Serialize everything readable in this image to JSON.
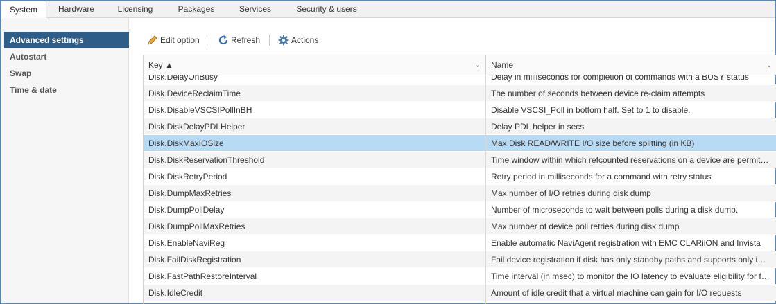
{
  "tabs": [
    {
      "label": "System",
      "active": true
    },
    {
      "label": "Hardware",
      "active": false
    },
    {
      "label": "Licensing",
      "active": false
    },
    {
      "label": "Packages",
      "active": false
    },
    {
      "label": "Services",
      "active": false
    },
    {
      "label": "Security & users",
      "active": false
    }
  ],
  "sidebar": {
    "items": [
      {
        "label": "Advanced settings",
        "active": true
      },
      {
        "label": "Autostart",
        "active": false
      },
      {
        "label": "Swap",
        "active": false
      },
      {
        "label": "Time & date",
        "active": false
      }
    ]
  },
  "toolbar": {
    "edit_label": "Edit option",
    "refresh_label": "Refresh",
    "actions_label": "Actions",
    "edit_icon": "pencil-icon",
    "refresh_icon": "refresh-icon",
    "actions_icon": "gear-icon"
  },
  "grid": {
    "columns": {
      "key": "Key ▲",
      "name": "Name"
    },
    "rows": [
      {
        "key": "Disk.DelayOnBusy",
        "name": "Delay in milliseconds for completion of commands with a BUSY status"
      },
      {
        "key": "Disk.DeviceReclaimTime",
        "name": "The number of seconds between device re-claim attempts"
      },
      {
        "key": "Disk.DisableVSCSIPollInBH",
        "name": "Disable VSCSI_Poll in bottom half. Set to 1 to disable."
      },
      {
        "key": "Disk.DiskDelayPDLHelper",
        "name": "Delay PDL helper in secs"
      },
      {
        "key": "Disk.DiskMaxIOSize",
        "name": "Max Disk READ/WRITE I/O size before splitting (in KB)",
        "selected": true
      },
      {
        "key": "Disk.DiskReservationThreshold",
        "name": "Time window within which refcounted reservations on a device are permitted"
      },
      {
        "key": "Disk.DiskRetryPeriod",
        "name": "Retry period in milliseconds for a command with retry status"
      },
      {
        "key": "Disk.DumpMaxRetries",
        "name": "Max number of I/O retries during disk dump"
      },
      {
        "key": "Disk.DumpPollDelay",
        "name": "Number of microseconds to wait between polls during a disk dump."
      },
      {
        "key": "Disk.DumpPollMaxRetries",
        "name": "Max number of device poll retries during disk dump"
      },
      {
        "key": "Disk.EnableNaviReg",
        "name": "Enable automatic NaviAgent registration with EMC CLARiiON and Invista"
      },
      {
        "key": "Disk.FailDiskRegistration",
        "name": "Fail device registration if disk has only standby paths and supports only implicit"
      },
      {
        "key": "Disk.FastPathRestoreInterval",
        "name": "Time interval (in msec) to monitor the IO latency to evaluate eligibility for fast path"
      },
      {
        "key": "Disk.IdleCredit",
        "name": "Amount of idle credit that a virtual machine can gain for I/O requests"
      }
    ]
  },
  "colors": {
    "selected_row": "#b8dbf5",
    "active_nav": "#2f5d8a",
    "border_accent": "#5b87b8"
  }
}
